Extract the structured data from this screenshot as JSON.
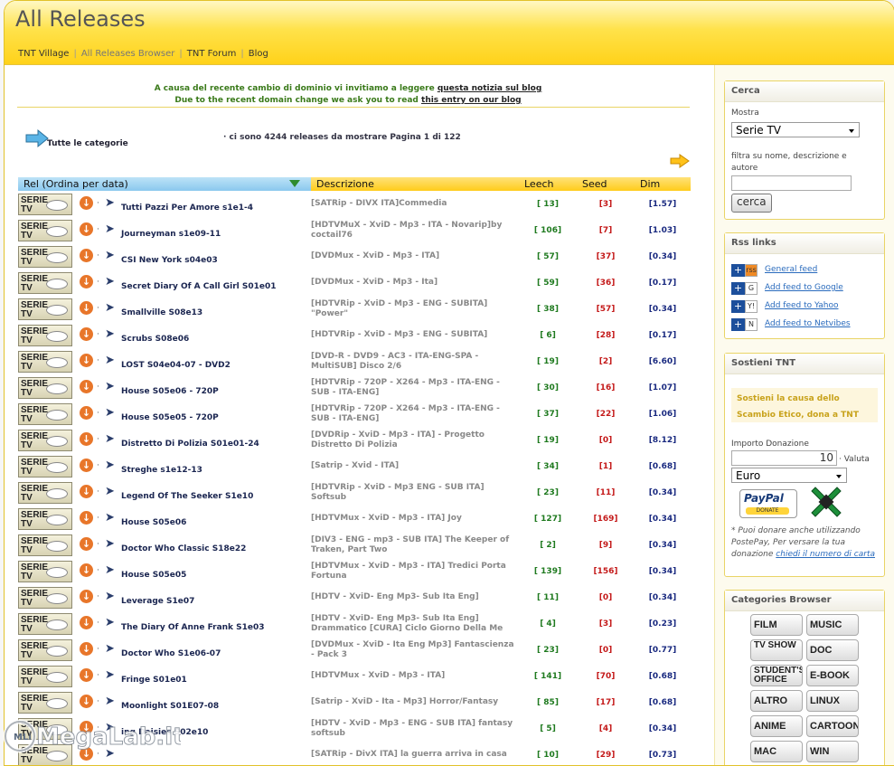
{
  "page": {
    "title": "All Releases"
  },
  "nav": [
    {
      "label": "TNT Village"
    },
    {
      "label": "All Releases Browser"
    },
    {
      "label": "TNT Forum"
    },
    {
      "label": "Blog"
    }
  ],
  "notice": {
    "it_text": "A causa del recente cambio di dominio vi invitiamo a leggere",
    "it_link": "questa notizia sul blog",
    "en_text": "Due to the recent domain change we ask you to read",
    "en_link": "this entry on our blog"
  },
  "categories_link": "Tutte le categorie",
  "summary": "· ci sono 4244 releases da mostrare Pagina 1 di 122",
  "table": {
    "columns": [
      "Rel (Ordina per data)",
      "Descrizione",
      "Leech",
      "Seed",
      "Dim"
    ],
    "badge": [
      "SERIE",
      "TV"
    ],
    "rows": [
      {
        "title": "Tutti Pazzi Per Amore s1e1-4",
        "desc": "[SATRip - DIVX ITA]Commedia",
        "leech": "[ 13]",
        "seed": "[3]",
        "dim": "[1.57]"
      },
      {
        "title": "Journeyman s1e09-11",
        "desc": "[HDTVMuX - XviD - Mp3 - ITA - Novarip]by coctail76",
        "leech": "[ 106]",
        "seed": "[7]",
        "dim": "[1.03]"
      },
      {
        "title": "CSI New York s04e03",
        "desc": "[DVDMux - XviD - Mp3 - ITA]",
        "leech": "[ 57]",
        "seed": "[37]",
        "dim": "[0.34]"
      },
      {
        "title": "Secret Diary Of A Call Girl S01e01",
        "desc": "[DVDMux - XviD - Mp3 - Ita]",
        "leech": "[ 59]",
        "seed": "[36]",
        "dim": "[0.17]"
      },
      {
        "title": "Smallville S08e13",
        "desc": "[HDTVRip - XviD - Mp3 - ENG - SUBITA] \"Power\"",
        "leech": "[ 38]",
        "seed": "[57]",
        "dim": "[0.34]"
      },
      {
        "title": "Scrubs S08e06",
        "desc": "[HDTVRip - XviD - Mp3 - ENG - SUBITA]",
        "leech": "[ 6]",
        "seed": "[28]",
        "dim": "[0.17]"
      },
      {
        "title": "LOST S04e04-07 - DVD2",
        "desc": "[DVD-R - DVD9 - AC3 - ITA-ENG-SPA - MultiSUB] Disco 2/6",
        "leech": "[ 19]",
        "seed": "[2]",
        "dim": "[6.60]"
      },
      {
        "title": "House S05e06 - 720P",
        "desc": "[HDTVRip - 720P - X264 - Mp3 - ITA-ENG - SUB - ITA-ENG]",
        "leech": "[ 30]",
        "seed": "[16]",
        "dim": "[1.07]"
      },
      {
        "title": "House S05e05 - 720P",
        "desc": "[HDTVRip - 720P - X264 - Mp3 - ITA-ENG - SUB - ITA-ENG]",
        "leech": "[ 37]",
        "seed": "[22]",
        "dim": "[1.06]"
      },
      {
        "title": "Distretto Di Polizia S01e01-24",
        "desc": "[DVDRip - XviD - Mp3 - ITA] - Progetto Distretto Di Polizia",
        "leech": "[ 19]",
        "seed": "[0]",
        "dim": "[8.12]"
      },
      {
        "title": "Streghe s1e12-13",
        "desc": "[Satrip - Xvid - ITA]",
        "leech": "[ 34]",
        "seed": "[1]",
        "dim": "[0.68]"
      },
      {
        "title": "Legend Of The Seeker S1e10",
        "desc": "[HDTVRip - XviD - Mp3 ENG - SUB ITA] Softsub",
        "leech": "[ 23]",
        "seed": "[11]",
        "dim": "[0.34]"
      },
      {
        "title": "House S05e06",
        "desc": "[HDTVMux - XviD - Mp3 - ITA] Joy",
        "leech": "[ 127]",
        "seed": "[169]",
        "dim": "[0.34]"
      },
      {
        "title": "Doctor Who Classic S18e22",
        "desc": "[DIV3 - ENG - mp3 - SUB ITA] The Keeper of Traken, Part Two",
        "leech": "[ 2]",
        "seed": "[9]",
        "dim": "[0.34]"
      },
      {
        "title": "House S05e05",
        "desc": "[HDTVMux - XviD - Mp3 - ITA] Tredici Porta Fortuna",
        "leech": "[ 139]",
        "seed": "[156]",
        "dim": "[0.34]"
      },
      {
        "title": "Leverage S1e07",
        "desc": "[HDTV - XviD- Eng Mp3- Sub Ita Eng]",
        "leech": "[ 11]",
        "seed": "[0]",
        "dim": "[0.34]"
      },
      {
        "title": "The Diary Of Anne Frank S1e03",
        "desc": "[HDTV - XviD- Eng Mp3- Sub Ita Eng] Drammatico [CURA] Ciclo Giorno Della Me",
        "leech": "[ 4]",
        "seed": "[3]",
        "dim": "[0.23]"
      },
      {
        "title": "Doctor Who S1e06-07",
        "desc": "[DVDMux - XviD - Ita Eng Mp3] Fantascienza - Pack 3",
        "leech": "[ 23]",
        "seed": "[0]",
        "dim": "[0.77]"
      },
      {
        "title": "Fringe S01e01",
        "desc": "[HDTVMux - XviD - Mp3 - ITA]",
        "leech": "[ 141]",
        "seed": "[70]",
        "dim": "[0.68]"
      },
      {
        "title": "Moonlight S01E07-08",
        "desc": "[Satrip - XviD - Ita - Mp3] Horror/Fantasy",
        "leech": "[ 85]",
        "seed": "[17]",
        "dim": "[0.68]"
      },
      {
        "title": "ing Daisies S02e10",
        "desc": "[HDTV - XviD - Mp3 - ENG - SUB ITA] fantasy softsub",
        "leech": "[ 5]",
        "seed": "[4]",
        "dim": "[0.34]"
      },
      {
        "title": "",
        "desc": "[SATRip - DivX ITA] la guerra arriva in casa",
        "leech": "[ 10]",
        "seed": "[29]",
        "dim": "[0.73]"
      }
    ]
  },
  "sidebar": {
    "search": {
      "title": "Cerca",
      "show_label": "Mostra",
      "show_value": "Serie TV",
      "filter_label": "filtra su nome, descrizione e autore",
      "filter_value": "",
      "button": "cerca"
    },
    "rss": {
      "title": "Rss links",
      "items": [
        {
          "label": "General feed",
          "icon2": "rss"
        },
        {
          "label": "Add feed to Google",
          "icon2": "G"
        },
        {
          "label": "Add feed to Yahoo",
          "icon2": "Y!"
        },
        {
          "label": "Add feed to Netvibes",
          "icon2": "N"
        }
      ]
    },
    "support": {
      "title": "Sostieni TNT",
      "cause": "Sostieni la causa dello Scambio Etico, dona a TNT",
      "amount_label": "Importo Donazione",
      "amount_value": "10",
      "currency_label": "· Valuta",
      "currency_value": "Euro",
      "paypal": "PayPal",
      "donate": "DONATE",
      "note_text": "* Puoi donare anche utilizzando PostePay, Per versare la tua donazione",
      "note_link": "chiedi il numero di carta"
    },
    "categories": {
      "title": "Categories Browser",
      "items": [
        "FILM",
        "MUSIC",
        "TV SHOW",
        "DOC",
        "STUDENT'S OFFICE",
        "E-BOOK",
        "ALTRO",
        "LINUX",
        "ANIME",
        "CARTOON",
        "MAC",
        "WIN"
      ]
    }
  },
  "watermark": "MegaLab.it"
}
